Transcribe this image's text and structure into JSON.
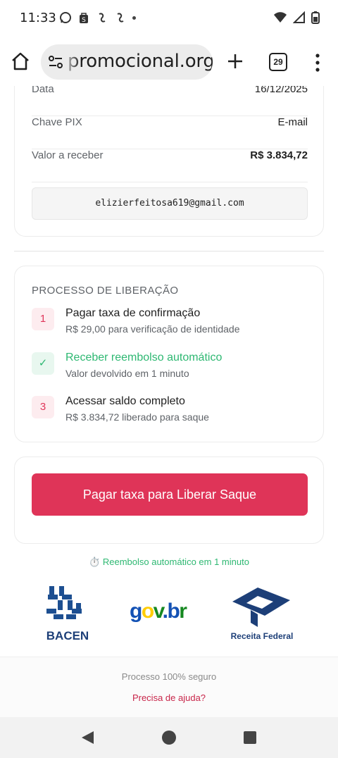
{
  "status_bar": {
    "time": "11:33",
    "left_icons": [
      "whatsapp-icon",
      "shopping-bag-icon",
      "sync-icon",
      "sync-icon",
      "dot-icon"
    ],
    "right_icons": [
      "wifi-icon",
      "signal-icon",
      "battery-icon"
    ]
  },
  "browser": {
    "url_text": "promocional.org",
    "tab_count": "29"
  },
  "details": {
    "rows": [
      {
        "label": "Data",
        "value": "16/12/2025"
      },
      {
        "label": "Chave PIX",
        "value": "E-mail"
      },
      {
        "label": "Valor a receber",
        "value": "R$ 3.834,72"
      }
    ],
    "email": "elizierfeitosa619@gmail.com"
  },
  "process": {
    "title": "PROCESSO DE LIBERAÇÃO",
    "steps": [
      {
        "marker": "1",
        "title": "Pagar taxa de confirmação",
        "desc": "R$ 29,00 para verificação de identidade",
        "status": "pending"
      },
      {
        "marker": "✓",
        "title": "Receber reembolso automático",
        "desc": "Valor devolvido em 1 minuto",
        "status": "done"
      },
      {
        "marker": "3",
        "title": "Acessar saldo completo",
        "desc": "R$ 3.834,72 liberado para saque",
        "status": "pending"
      }
    ]
  },
  "cta": {
    "label": "Pagar taxa para Liberar Saque"
  },
  "refund_note": "⏱️ Reembolso automático em 1 minuto",
  "logos": {
    "bacen": "BACEN",
    "govbr": "gov.br",
    "receita": "Receita Federal"
  },
  "footer": {
    "secure_text": "Processo 100% seguro",
    "help_link": "Precisa de ajuda?"
  },
  "colors": {
    "accent": "#df3458",
    "success": "#2eb872",
    "muted": "#5f6368"
  }
}
